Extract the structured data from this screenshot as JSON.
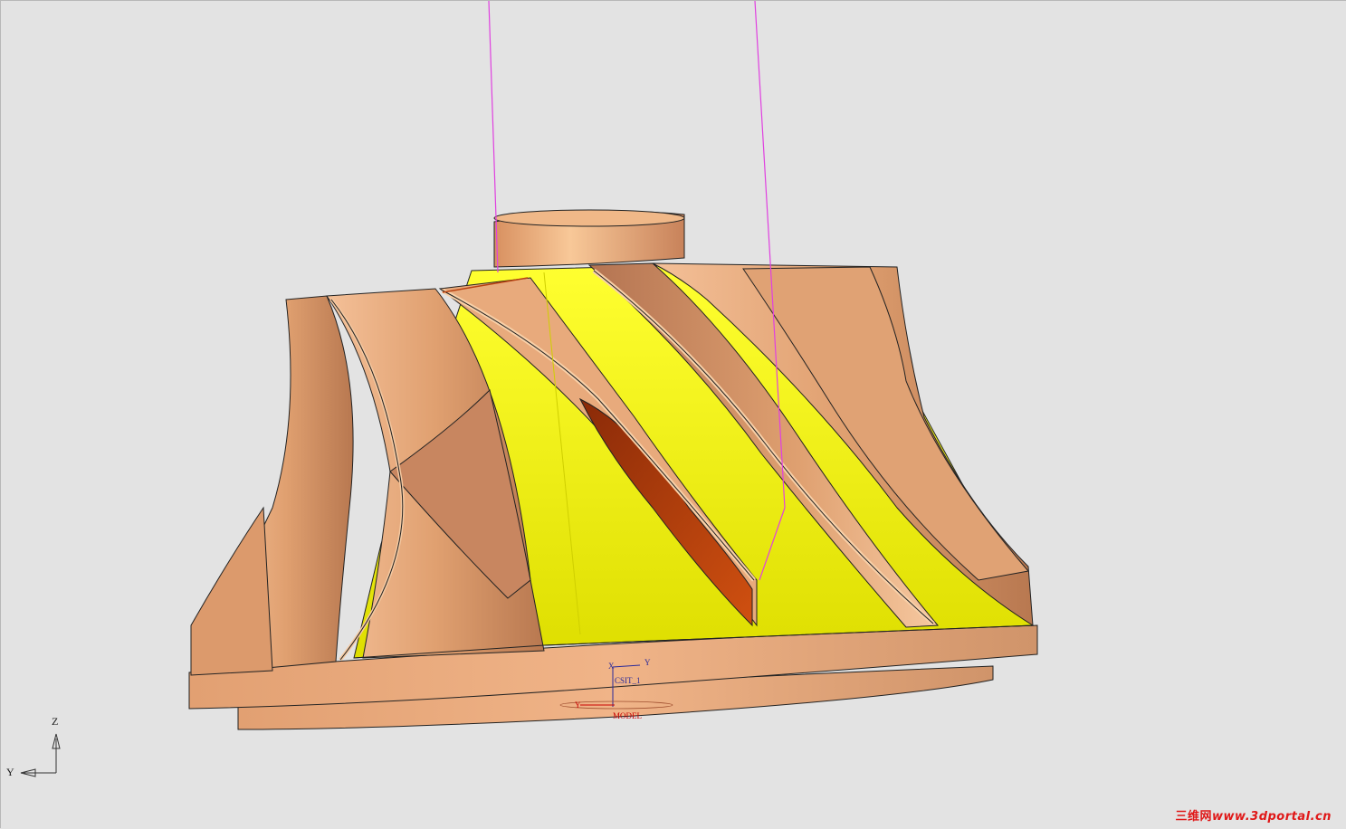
{
  "viewport": {
    "background": "#e3e3e3"
  },
  "triad": {
    "z_label": "Z",
    "y_label": "Y"
  },
  "model": {
    "csys_name": "CSIT_1",
    "csys_axis_y": "Y",
    "csys_axis_x": "X",
    "model_label": "MODEL",
    "model_axis_y": "Y",
    "colors": {
      "blade": "#e8a878",
      "blade_dark": "#b87a54",
      "hub_surface": "#f4f400",
      "hub_shadow": "#d8d800",
      "cut_face": "#b8400c",
      "toolpath": "#e040e0",
      "edge": "#222222"
    }
  },
  "watermark": {
    "brand": "三维网",
    "url": "www.3dportal.cn"
  }
}
